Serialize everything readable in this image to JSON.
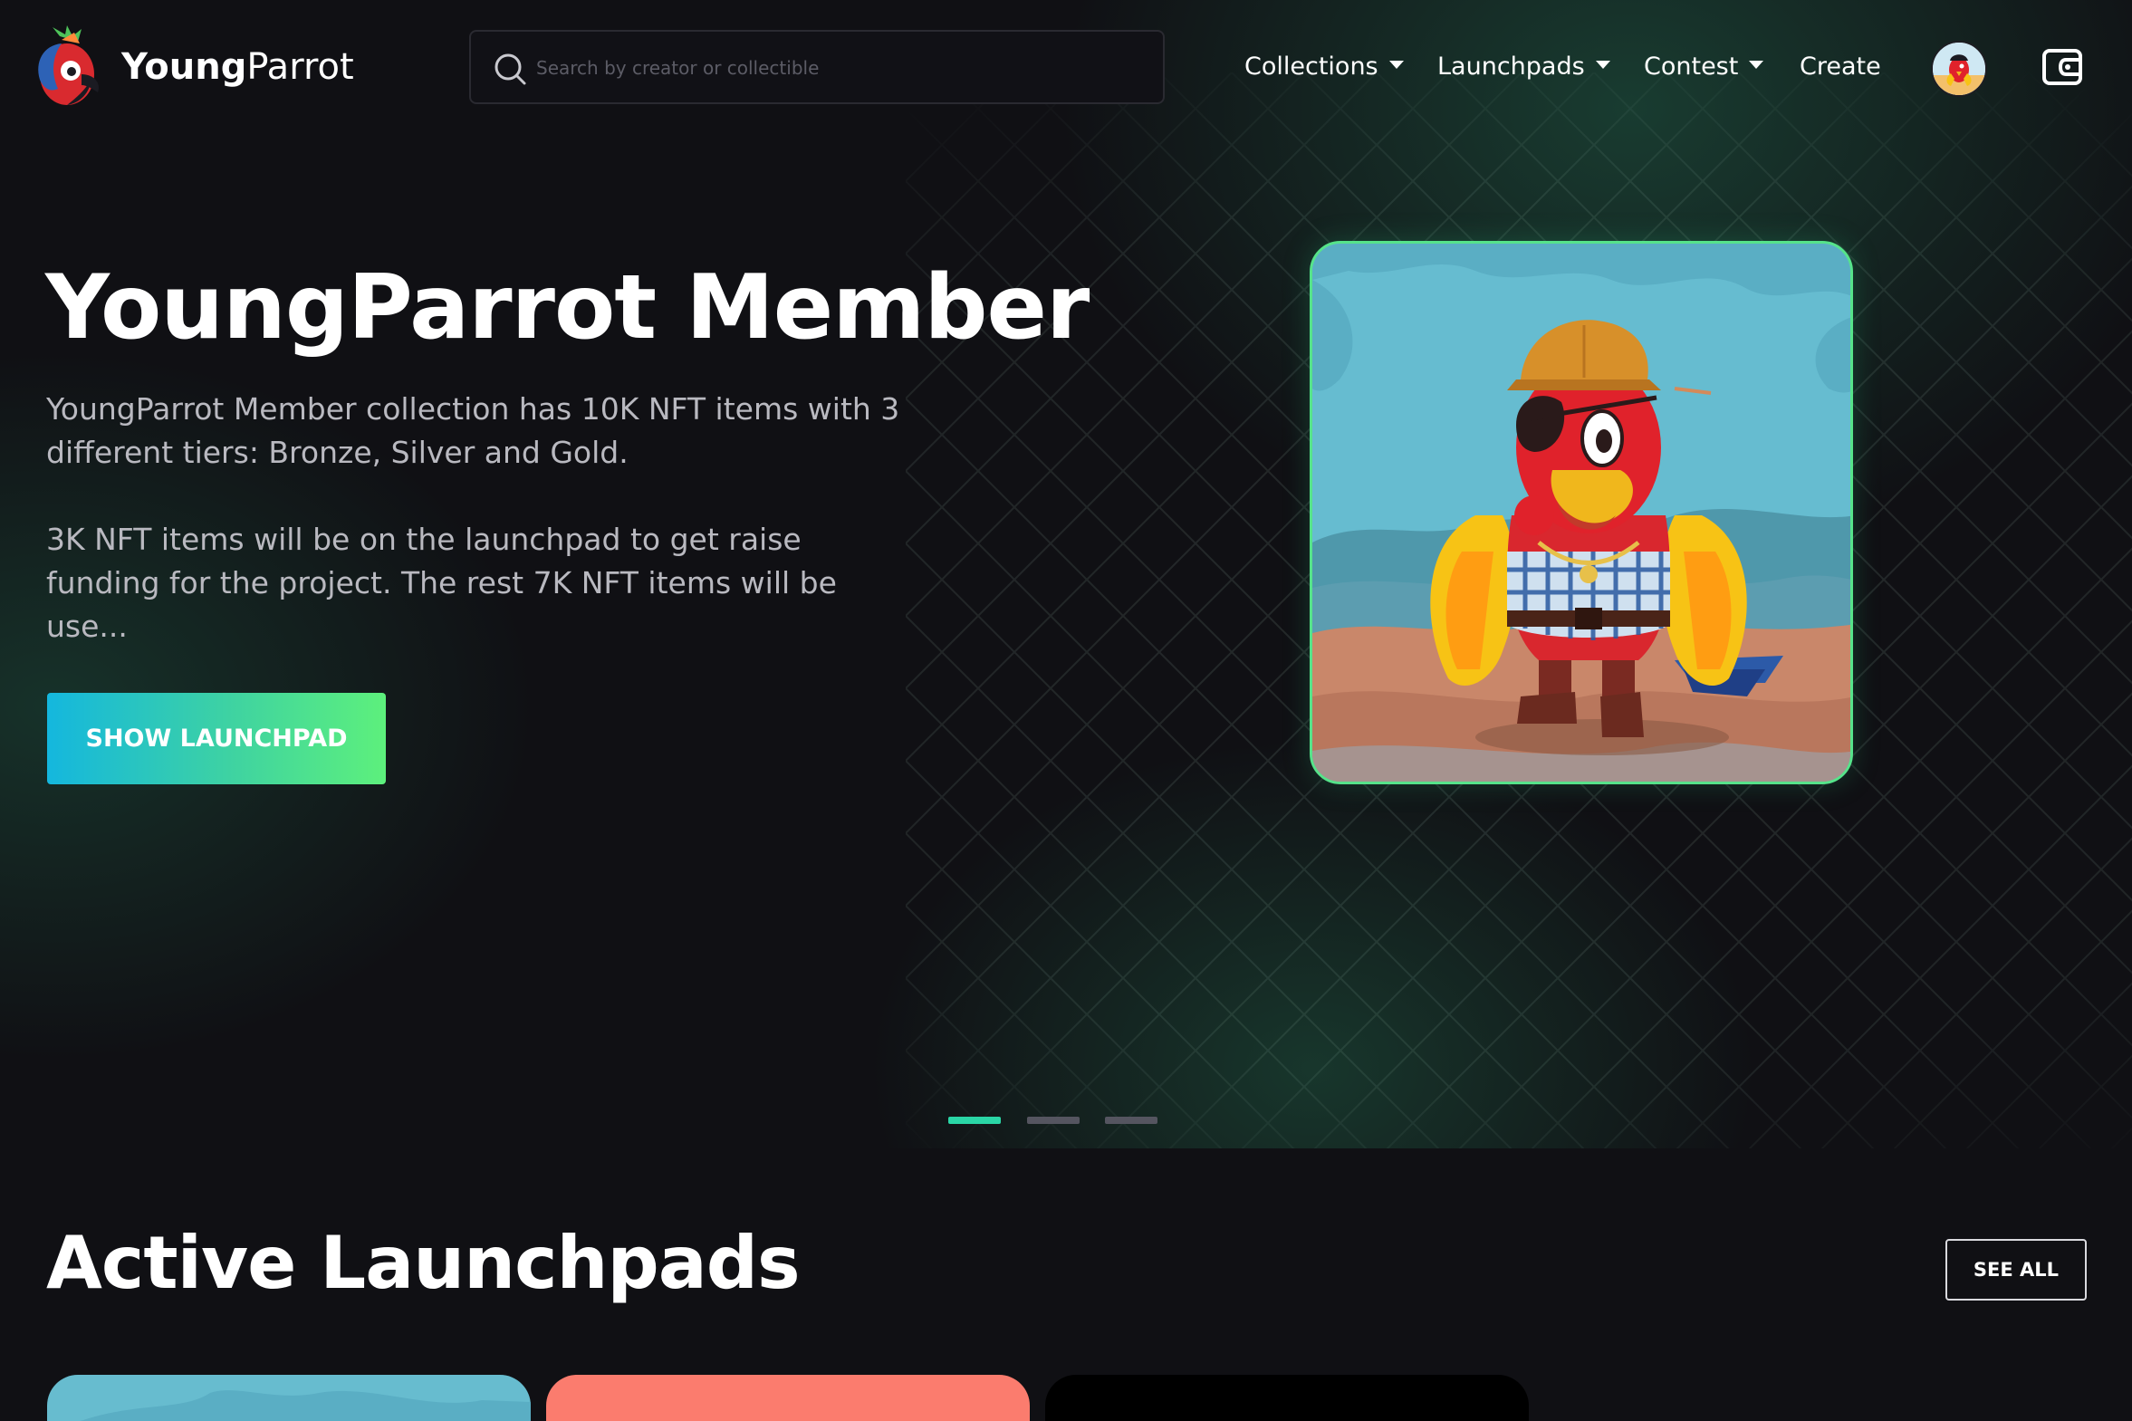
{
  "header": {
    "brand_bold": "Young",
    "brand_regular": "Parrot",
    "search_placeholder": "Search by creator or collectible",
    "nav": {
      "collections": "Collections",
      "launchpads": "Launchpads",
      "contest": "Contest",
      "create": "Create"
    }
  },
  "hero": {
    "title": "YoungParrot Member",
    "paragraph_1": "YoungParrot Member collection has 10K NFT items with 3 different tiers: Bronze, Silver and Gold.",
    "paragraph_2": "3K NFT items will be on the launchpad to get raise funding for the project. The rest 7K NFT items will be use...",
    "button": "SHOW LAUNCHPAD",
    "slides_total": 3,
    "slide_active": 1
  },
  "launchpads": {
    "title": "Active Launchpads",
    "see_all": "SEE ALL"
  },
  "colors": {
    "background": "#101014",
    "accent_cyan": "#14b7de",
    "accent_green": "#5df07c",
    "dot_active": "#2ad6a6",
    "dot_inactive": "#555560",
    "card_1": "#67bccf",
    "card_2": "#fb7c6e",
    "card_3": "#000000"
  },
  "icons": {
    "logo": "parrot-logo-icon",
    "search": "search-icon",
    "caret": "caret-down-icon",
    "wallet": "wallet-icon",
    "avatar": "user-avatar"
  }
}
